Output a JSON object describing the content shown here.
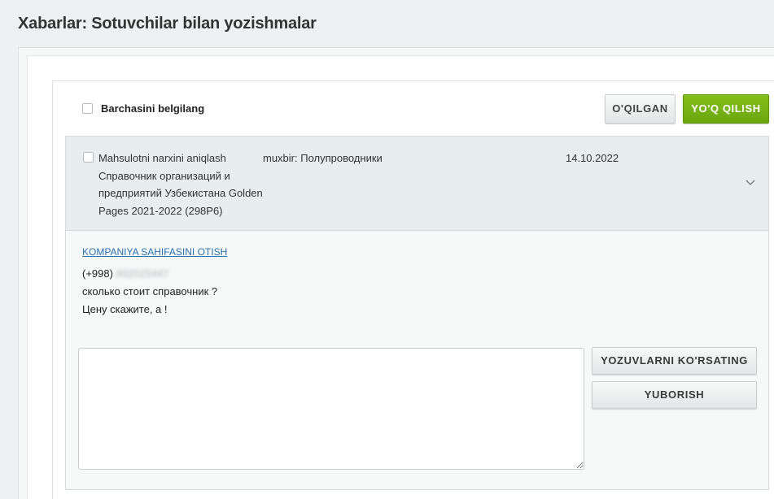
{
  "page": {
    "title": "Xabarlar: Sotuvchilar bilan yozishmalar"
  },
  "toolbar": {
    "select_all_label": "Barchasini belgilang",
    "read_label": "O'QILGAN",
    "delete_label": "YO'Q QILISH",
    "delete_color": "#78b214"
  },
  "message": {
    "subject": "Mahsulotni narxini aniqlash Справочник организаций и предприятий Узбекистана Golden Pages 2021-2022 (298P6)",
    "sender": "muxbir: Полупроводники",
    "date": "14.10.2022",
    "company_link": "KOMPANIYA SAHIFASINI OTISH",
    "phone_prefix": "(+998)",
    "phone_number": "932025447",
    "body_line1": "сколько стоит справочник ?",
    "body_line2": "Цену скажите, а !"
  },
  "reply": {
    "placeholder": "",
    "show_notes_label": "YOZUVLARNI KO'RSATING",
    "send_label": "YUBORISH"
  },
  "icons": {
    "expand": "chevron-down-icon"
  }
}
